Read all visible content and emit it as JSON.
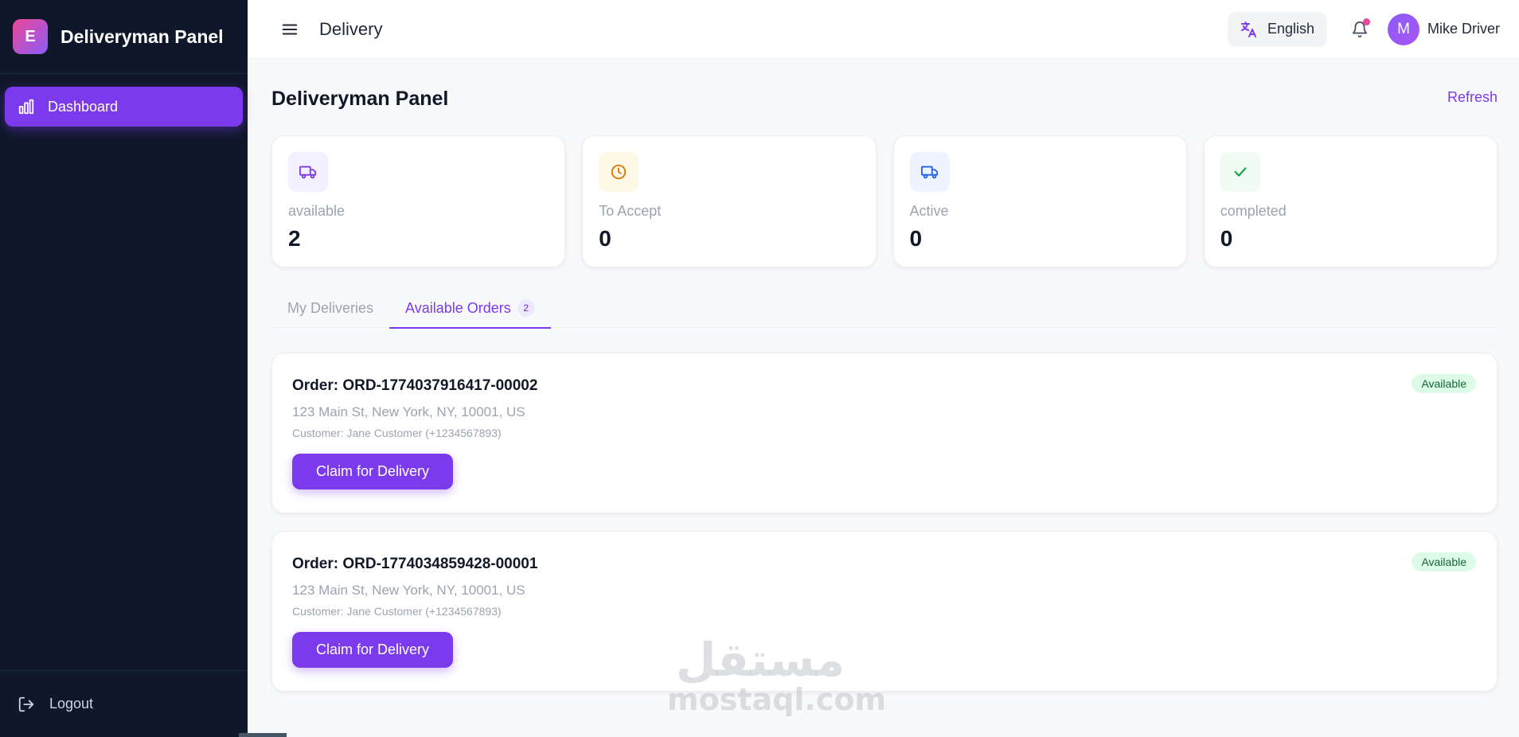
{
  "sidebar": {
    "logo_letter": "E",
    "brand": "Deliveryman Panel",
    "nav_items": [
      {
        "label": "Dashboard",
        "icon": "bar-chart-icon"
      }
    ],
    "logout_label": "Logout"
  },
  "header": {
    "title": "Delivery",
    "language": "English",
    "user_initial": "M",
    "user_name": "Mike Driver"
  },
  "main": {
    "title": "Deliveryman Panel",
    "refresh_label": "Refresh",
    "stats": [
      {
        "label": "available",
        "value": "2",
        "icon": "truck-icon",
        "color": "#7c3aed",
        "bg": "#f3f0ff"
      },
      {
        "label": "To Accept",
        "value": "0",
        "icon": "clock-icon",
        "color": "#d97706",
        "bg": "#fef9e7"
      },
      {
        "label": "Active",
        "value": "0",
        "icon": "truck-icon",
        "color": "#2563eb",
        "bg": "#eef4ff"
      },
      {
        "label": "completed",
        "value": "0",
        "icon": "check-icon",
        "color": "#16a34a",
        "bg": "#effbf3"
      }
    ],
    "tabs": [
      {
        "label": "My Deliveries"
      },
      {
        "label": "Available Orders",
        "badge": "2"
      }
    ],
    "orders": [
      {
        "id": "Order: ORD-1774037916417-00002",
        "address": "123 Main St, New York, NY, 10001, US",
        "customer": "Customer: Jane Customer (+1234567893)",
        "button": "Claim for Delivery",
        "status": "Available"
      },
      {
        "id": "Order: ORD-1774034859428-00001",
        "address": "123 Main St, New York, NY, 10001, US",
        "customer": "Customer: Jane Customer (+1234567893)",
        "button": "Claim for Delivery",
        "status": "Available"
      }
    ]
  },
  "watermark": {
    "arabic": "مستقل",
    "latin": "mostaql.com"
  },
  "colors": {
    "accent": "#7c3aed",
    "sidebar_bg": "#0f172a",
    "available_badge_bg": "#dcfce7"
  }
}
